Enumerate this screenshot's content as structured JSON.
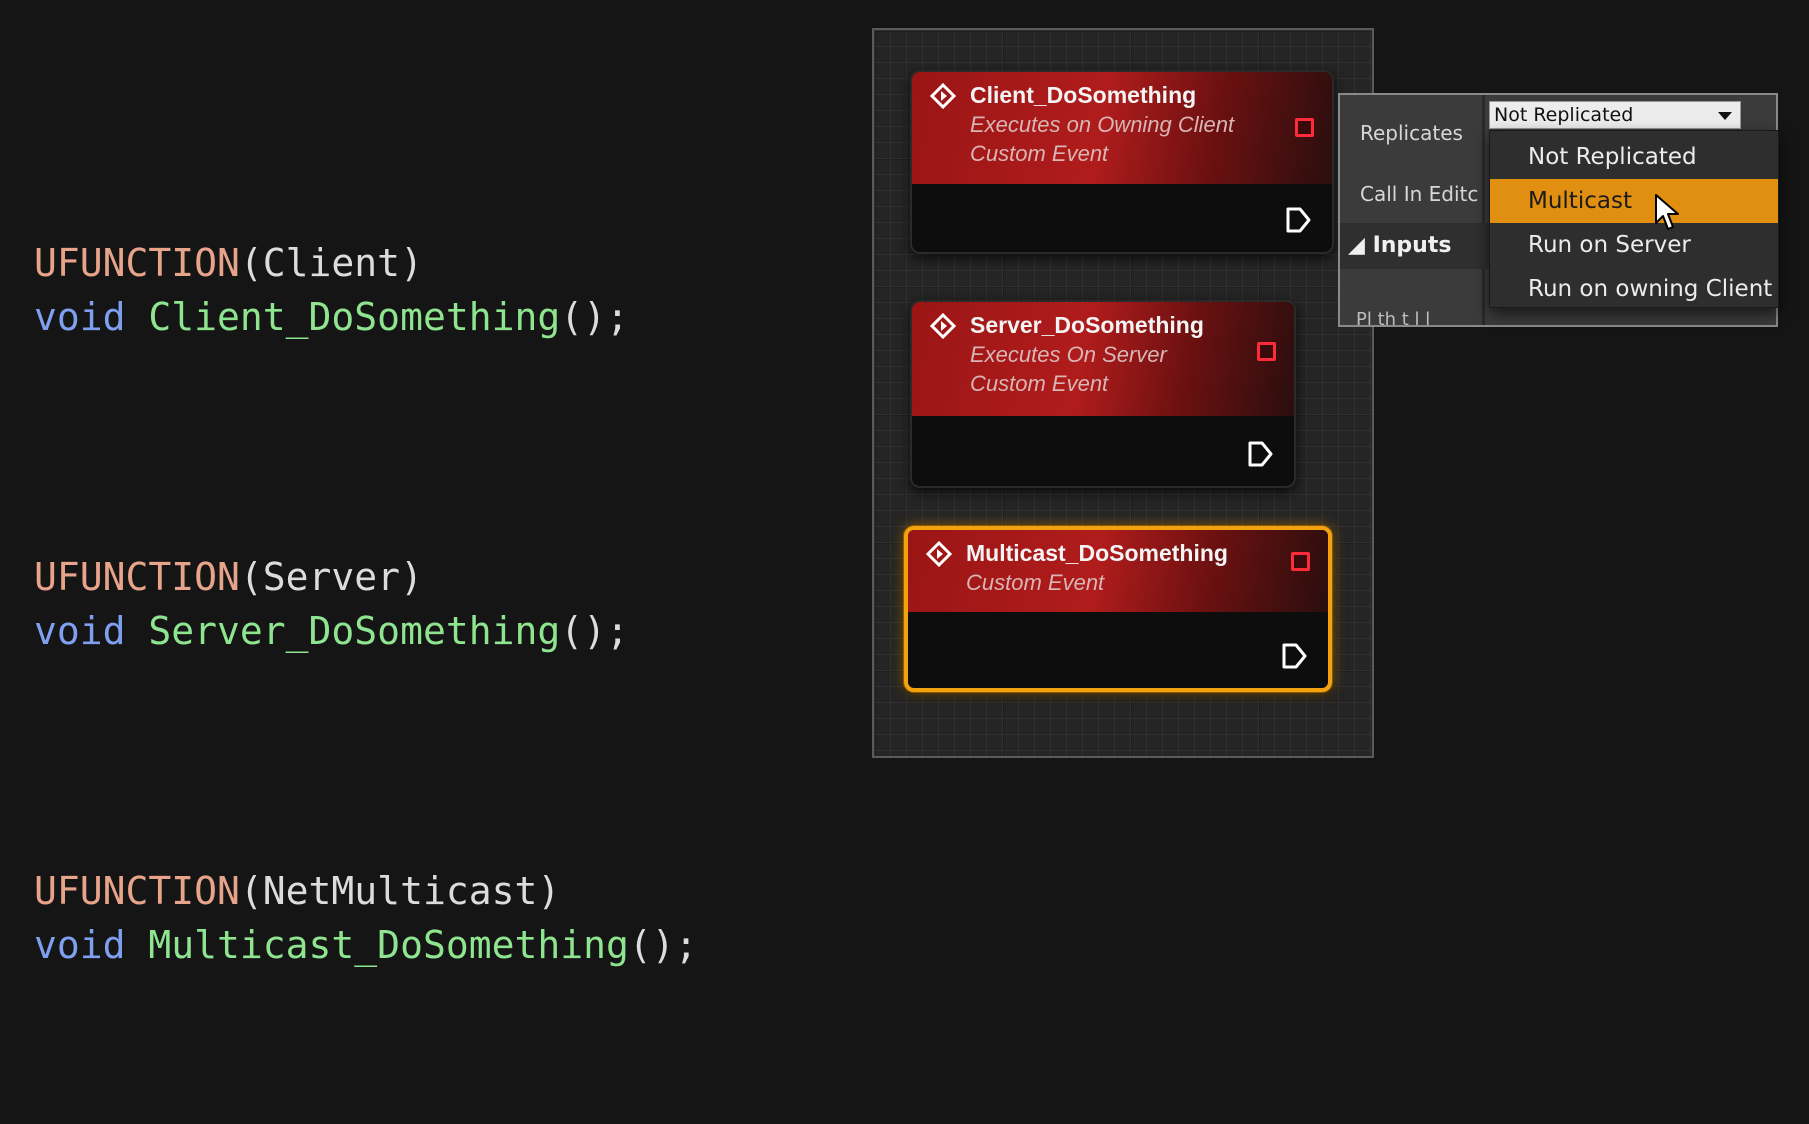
{
  "code": {
    "blocks": [
      {
        "macro": "UFUNCTION",
        "spec": "Client",
        "keyword": "void",
        "function": "Client_DoSomething",
        "suffix": "();"
      },
      {
        "macro": "UFUNCTION",
        "spec": "Server",
        "keyword": "void",
        "function": "Server_DoSomething",
        "suffix": "();"
      },
      {
        "macro": "UFUNCTION",
        "spec": "NetMulticast",
        "keyword": "void",
        "function": "Multicast_DoSomething",
        "suffix": "();"
      }
    ]
  },
  "graph": {
    "nodes": [
      {
        "title": "Client_DoSomething",
        "subtitle1": "Executes on Owning Client",
        "subtitle2": "Custom Event",
        "selected": false
      },
      {
        "title": "Server_DoSomething",
        "subtitle1": "Executes On Server",
        "subtitle2": "Custom Event",
        "selected": false
      },
      {
        "title": "Multicast_DoSomething",
        "subtitle1": "Custom Event",
        "selected": true
      }
    ]
  },
  "details": {
    "replicates_label": "Replicates",
    "call_in_editor_label": "Call In Editc",
    "inputs_label": "Inputs",
    "bottom_text": "Pl                    th    t        l  l"
  },
  "replicates_dropdown": {
    "selected_value": "Not Replicated",
    "options": [
      "Not Replicated",
      "Multicast",
      "Run on Server",
      "Run on owning Client"
    ],
    "highlighted": "Multicast"
  },
  "colors": {
    "macro": "#e8a48a",
    "keyword": "#7f9ff0",
    "function": "#8fe58f",
    "node_header": "#b01c1c",
    "selection": "#f2a20e",
    "menu_highlight": "#e08f10"
  }
}
